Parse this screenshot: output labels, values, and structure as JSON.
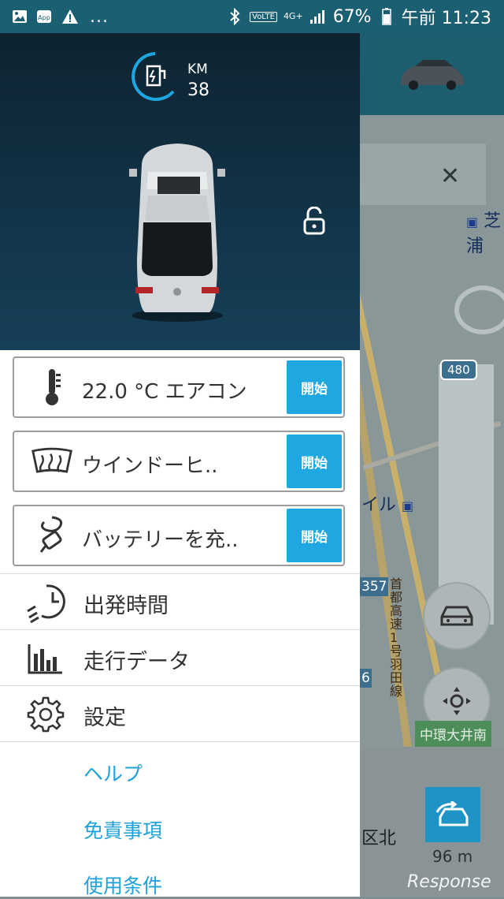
{
  "status_bar": {
    "app_badge": "App",
    "dots": "...",
    "volte": "VoLTE",
    "network": "4G+",
    "battery": "67%",
    "time": "午前 11:23"
  },
  "vehicle": {
    "range_unit": "KM",
    "range_value": "38",
    "lock_state": "unlocked"
  },
  "actions": [
    {
      "icon": "thermometer-icon",
      "label": "22.0 °C エアコン",
      "button": "開始"
    },
    {
      "icon": "windshield-heat-icon",
      "label": "ウインドーヒ..",
      "button": "開始"
    },
    {
      "icon": "charging-plug-icon",
      "label": "バッテリーを充..",
      "button": "開始"
    }
  ],
  "menu": [
    {
      "icon": "departure-time-icon",
      "label": "出発時間"
    },
    {
      "icon": "trip-data-icon",
      "label": "走行データ"
    },
    {
      "icon": "gear-icon",
      "label": "設定"
    }
  ],
  "links": [
    {
      "label": "ヘルプ"
    },
    {
      "label": "免責事項"
    },
    {
      "label": "使用条件"
    }
  ],
  "map": {
    "label_shiba": "芝浦",
    "route_480": "480",
    "label_ru": "イル",
    "route_357": "357",
    "route_6": "6",
    "expressway_label": "首都高速1号羽田線",
    "green_sign": "中環大井南",
    "district": "区北",
    "distance": "96 m",
    "watermark": "Response"
  },
  "colors": {
    "accent": "#1ea7e1",
    "status_bar": "#1b5f73",
    "hero_dark": "#0e2330"
  }
}
